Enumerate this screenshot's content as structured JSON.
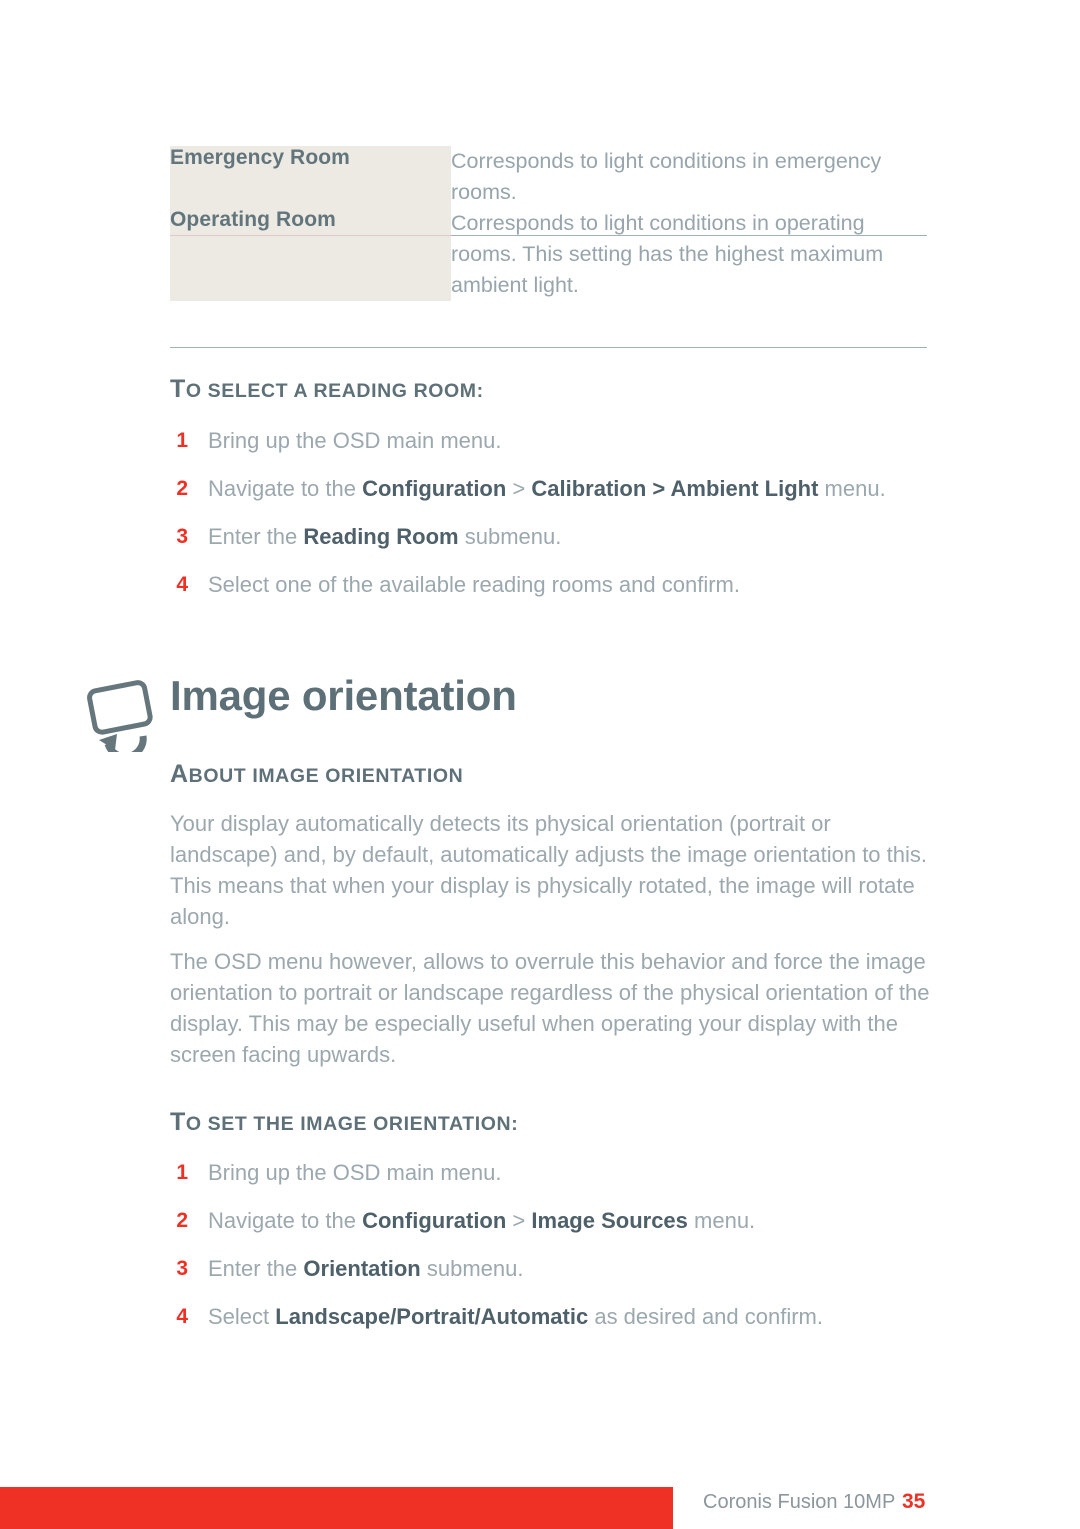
{
  "table": {
    "rows": [
      {
        "term": "Emergency Room",
        "description": "Corresponds to light conditions in emergency rooms."
      },
      {
        "term": "Operating Room",
        "description": "Corresponds to light conditions in operating rooms. This setting has the highest maximum ambient light."
      }
    ]
  },
  "section_reading_room": {
    "heading_cap": "T",
    "heading_rest": "O SELECT A READING ROOM:",
    "steps": [
      {
        "num": "1",
        "pre": "Bring up the OSD main menu.",
        "bold1": "",
        "mid": "",
        "bold2": "",
        "post": ""
      },
      {
        "num": "2",
        "pre": "Navigate to the ",
        "bold1": "Configuration",
        "mid": " > ",
        "bold2": "Calibration > Ambient Light",
        "post": " menu."
      },
      {
        "num": "3",
        "pre": "Enter the ",
        "bold1": "Reading Room",
        "mid": "",
        "bold2": "",
        "post": " submenu."
      },
      {
        "num": "4",
        "pre": "Select one of the available reading rooms and confirm.",
        "bold1": "",
        "mid": "",
        "bold2": "",
        "post": ""
      }
    ]
  },
  "chapter": {
    "title": "Image orientation",
    "icon": "rotate-display-icon"
  },
  "section_about": {
    "heading_cap": "A",
    "heading_rest": "BOUT IMAGE ORIENTATION",
    "paragraph_1": "Your display automatically detects its physical orientation (portrait or landscape) and, by default, automatically adjusts the image orientation to this. This means that when your display is physically rotated, the image will rotate along.",
    "paragraph_2": "The OSD menu however, allows to overrule this behavior and force the image orientation to portrait or landscape regardless of the physical orientation of the display. This may be especially useful when operating your display with the screen facing upwards."
  },
  "section_set_orientation": {
    "heading_cap": "T",
    "heading_rest": "O SET THE IMAGE ORIENTATION:",
    "steps": [
      {
        "num": "1",
        "pre": "Bring up the OSD main menu.",
        "bold1": "",
        "mid": "",
        "bold2": "",
        "post": ""
      },
      {
        "num": "2",
        "pre": "Navigate to the ",
        "bold1": "Configuration",
        "mid": " > ",
        "bold2": "Image Sources",
        "post": " menu."
      },
      {
        "num": "3",
        "pre": "Enter the ",
        "bold1": "Orientation",
        "mid": "",
        "bold2": "",
        "post": " submenu."
      },
      {
        "num": "4",
        "pre": "Select ",
        "bold1": "Landscape/Portrait/Automatic",
        "mid": "",
        "bold2": "",
        "post": " as desired and confirm."
      }
    ]
  },
  "footer": {
    "product": "Coronis Fusion 10MP",
    "page_number": "35",
    "bar_color": "#EE3124"
  },
  "colors": {
    "accent_red": "#EE3124",
    "slate": "#5E7077",
    "body_gray": "#9BA8AE",
    "table_term_bg": "#EDEAE4",
    "rule": "#9FB2B6"
  }
}
